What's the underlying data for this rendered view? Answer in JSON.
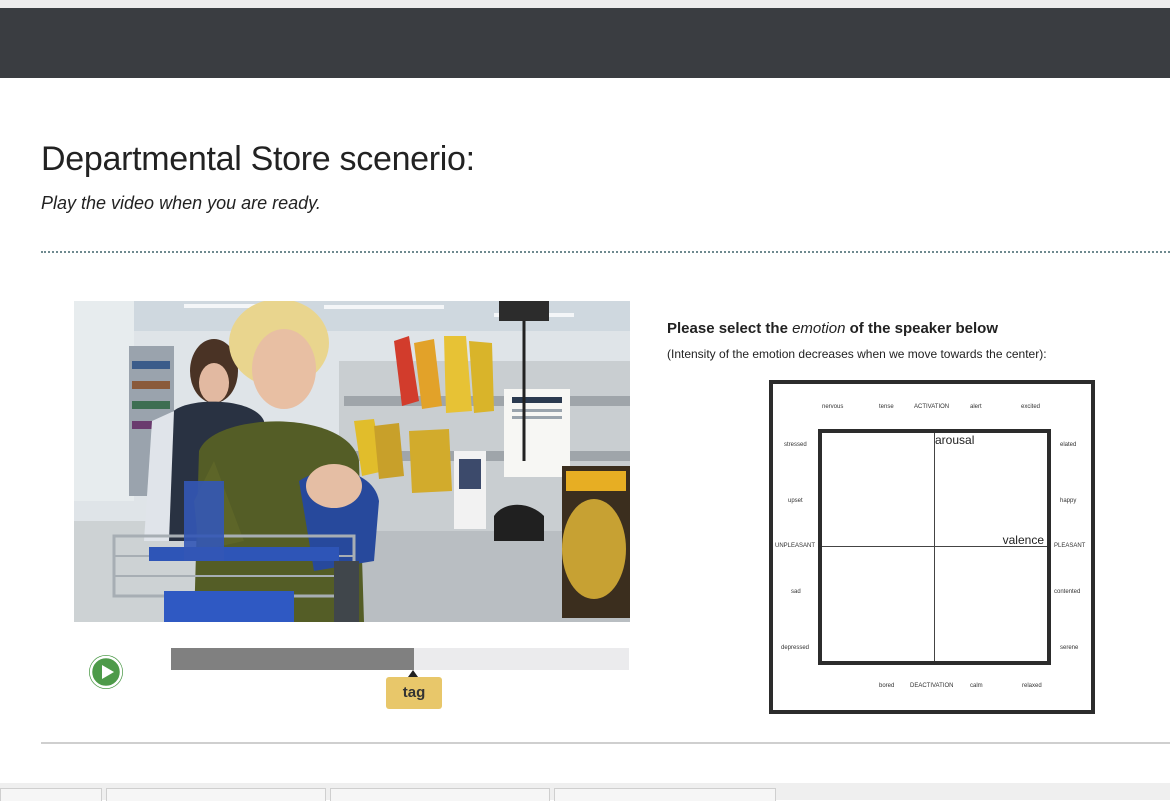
{
  "page": {
    "title": "Departmental Store scenerio:",
    "subtitle": "Play the video when you are ready."
  },
  "player": {
    "play_icon": "play-icon",
    "progress_fraction": 0.53,
    "tag_label": "tag"
  },
  "emotion": {
    "prompt_before": "Please select the ",
    "prompt_em": "emotion",
    "prompt_after": " of the speaker below",
    "hint": "(Intensity of the emotion decreases when we move towards the center):",
    "axis_y": "arousal",
    "axis_x": "valence",
    "top": [
      "nervous",
      "tense",
      "ACTIVATION",
      "alert",
      "excited"
    ],
    "left": [
      "stressed",
      "upset",
      "UNPLEASANT",
      "sad",
      "depressed"
    ],
    "right": [
      "elated",
      "happy",
      "PLEASANT",
      "contented",
      "serene"
    ],
    "bottom": [
      "bored",
      "DEACTIVATION",
      "calm",
      "relaxed"
    ]
  },
  "colors": {
    "navbar": "#3a3d41",
    "play_button": "#4d9a49",
    "tag_button": "#e8c76a",
    "progress_fill": "#808080"
  }
}
